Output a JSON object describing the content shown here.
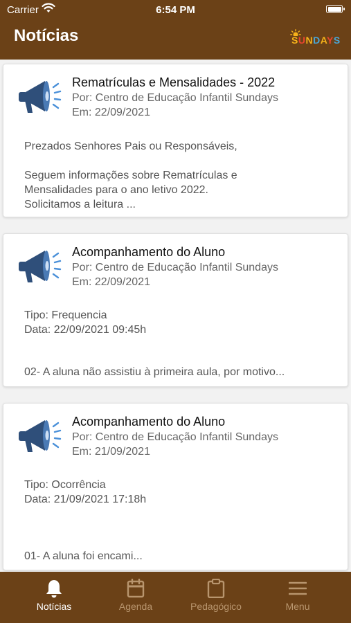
{
  "status_bar": {
    "carrier": "Carrier",
    "time": "6:54 PM"
  },
  "header": {
    "title": "Notícias",
    "brand_logo": "SUNDAYS"
  },
  "posts": [
    {
      "title": "Rematrículas e Mensalidades - 2022",
      "author": "Por: Centro de Educação Infantil Sundays",
      "date": "Em: 22/09/2021",
      "line1": "Prezados Senhores Pais ou Responsáveis,",
      "line2": "Seguem informações sobre Rematrículas e",
      "line3": "Mensalidades para o ano letivo 2022.",
      "line4": "Solicitamos a leitura ..."
    },
    {
      "title": "Acompanhamento do Aluno",
      "author": "Por: Centro de Educação Infantil Sundays",
      "date": "Em: 22/09/2021",
      "line1": "Tipo: Frequencia",
      "line2": "Data: 22/09/2021 09:45h",
      "line3": "02- A aluna não assistiu à primeira aula, por motivo..."
    },
    {
      "title": "Acompanhamento do Aluno",
      "author": "Por: Centro de Educação Infantil Sundays",
      "date": "Em: 21/09/2021",
      "line1": "Tipo: Ocorrência",
      "line2": "Data: 21/09/2021 17:18h",
      "line3": "01- A aluna foi encami..."
    }
  ],
  "tabs": [
    {
      "label": "Notícias",
      "icon": "bell-icon",
      "active": true
    },
    {
      "label": "Agenda",
      "icon": "calendar-icon",
      "active": false
    },
    {
      "label": "Pedagógico",
      "icon": "clipboard-icon",
      "active": false
    },
    {
      "label": "Menu",
      "icon": "hamburger-menu-icon",
      "active": false
    }
  ],
  "colors": {
    "brand_brown": "#6b4117",
    "tab_inactive": "#b8956e",
    "megaphone_blue": "#2f4f7a"
  }
}
